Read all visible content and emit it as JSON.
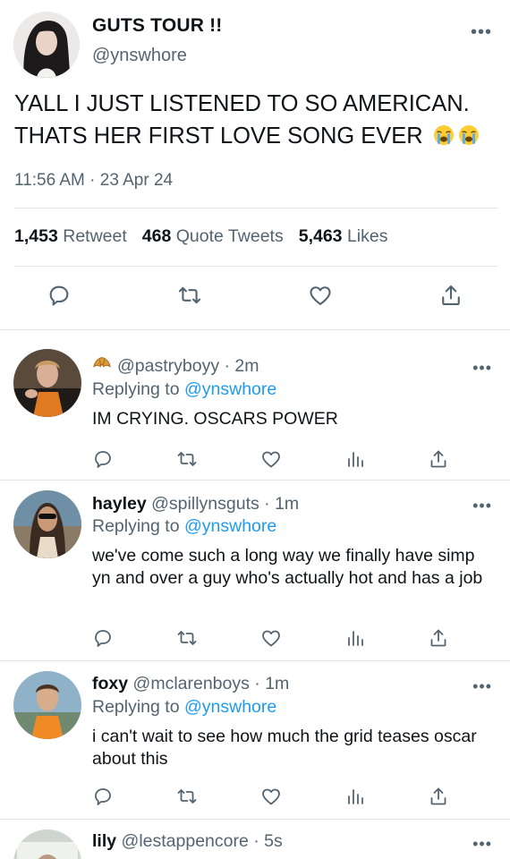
{
  "main_tweet": {
    "name": "GUTS TOUR !!",
    "handle": "@ynswhore",
    "text": "YALL I JUST LISTENED TO SO AMERICAN. THATS HER FIRST LOVE SONG EVER",
    "emojis": [
      "loudly-crying-face",
      "loudly-crying-face"
    ],
    "timestamp": "11:56 AM · 23 Apr 24",
    "stats": {
      "retweets_count": "1,453",
      "retweets_label": "Retweet",
      "quotes_count": "468",
      "quotes_label": "Quote Tweets",
      "likes_count": "5,463",
      "likes_label": "Likes"
    },
    "actions": [
      "reply-icon",
      "retweet-icon",
      "like-icon",
      "share-icon"
    ],
    "more_label": "•••"
  },
  "replies": [
    {
      "name": "",
      "name_emoji": "croissant",
      "handle": "@pastryboyy",
      "time": "· 2m",
      "replying_label": "Replying to",
      "replying_to": "@ynswhore",
      "text": "IM CRYING. OSCARS POWER",
      "more_label": "•••"
    },
    {
      "name": "hayley",
      "handle": "@spillynsguts",
      "time": "· 1m",
      "replying_label": "Replying to",
      "replying_to": "@ynswhore",
      "text": "we've come such a long way we finally have simp yn and over a guy who's actually hot and has a job",
      "more_label": "•••"
    },
    {
      "name": "foxy",
      "handle": "@mclarenboys",
      "time": "· 1m",
      "replying_label": "Replying to",
      "replying_to": "@ynswhore",
      "text": "i can't wait to see how much the grid teases oscar about this",
      "more_label": "•••"
    },
    {
      "name": "lily",
      "handle": "@lestappencore",
      "time": "· 5s",
      "more_label": "•••"
    }
  ],
  "colors": {
    "text": "#0f1419",
    "secondary": "#536471",
    "link": "#1d9bf0",
    "divider": "#e1e6ea"
  }
}
